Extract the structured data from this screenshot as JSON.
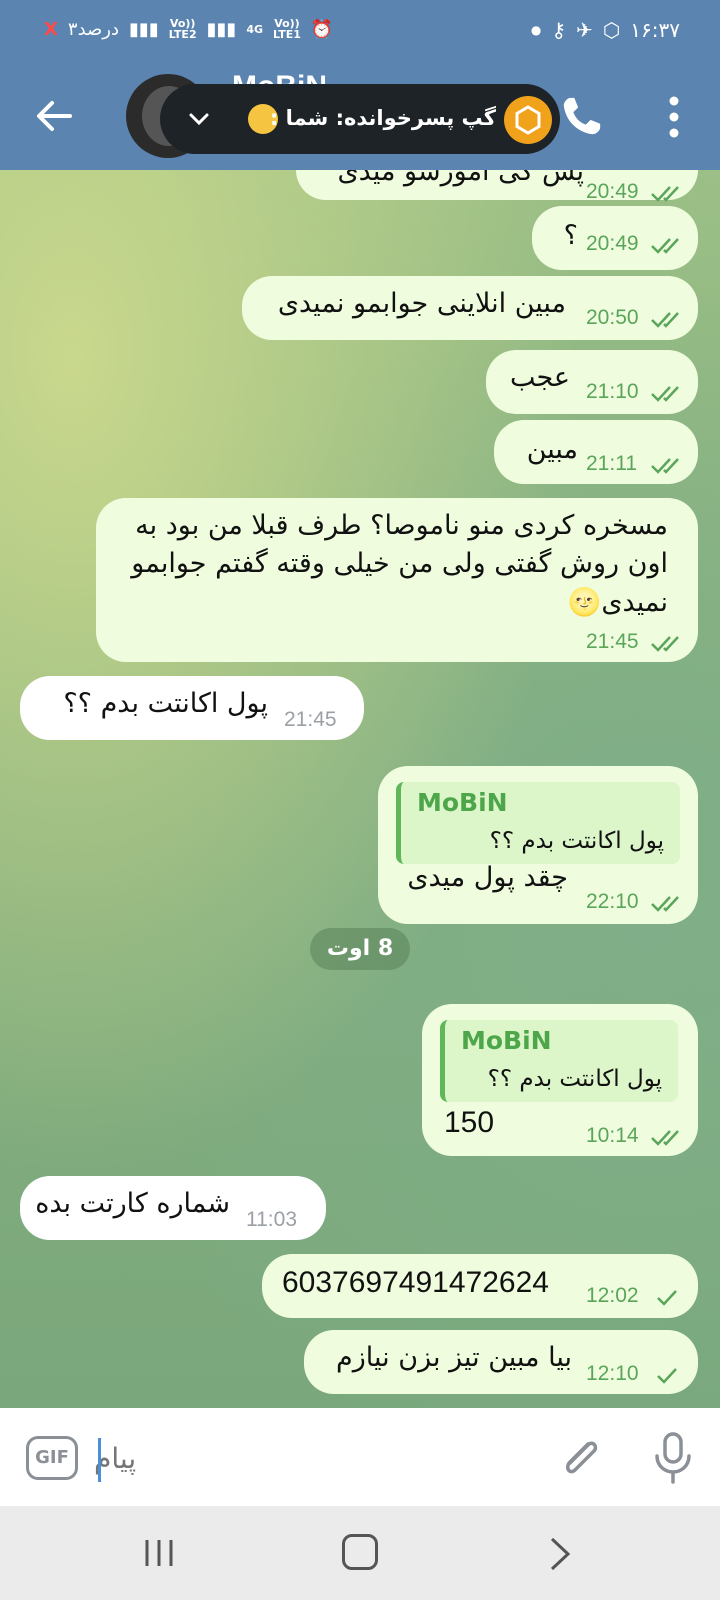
{
  "status_bar": {
    "time": "۱۶:۳۷",
    "battery": "۳درصد",
    "sim1": "LTE2",
    "sim2": "LTE1",
    "net": "4G"
  },
  "notification": {
    "text": "گپ پسرخوانده: شما :",
    "emoji": "😐"
  },
  "header": {
    "contact_name": "MoBiN"
  },
  "messages": [
    {
      "text": "پس کی آمورشو میدی",
      "time": "20:49",
      "checks": 2
    },
    {
      "text": "؟",
      "time": "20:49",
      "checks": 2
    },
    {
      "text": "مبین انلاینی جوابمو نمیدی",
      "time": "20:50",
      "checks": 2
    },
    {
      "text": "عجب",
      "time": "21:10",
      "checks": 2
    },
    {
      "text": "مبین",
      "time": "21:11",
      "checks": 2
    },
    {
      "lines": [
        "مسخره کردی منو ناموصا؟ طرف قبلا من بود به",
        "اون روش گفتی ولی من خیلی وقته گفتم جوابمو",
        "نمیدی🌝"
      ],
      "time": "21:45",
      "checks": 2
    },
    {
      "text": "پول اکانتت بدم ؟؟",
      "time": "21:45"
    },
    {
      "reply_name": "MoBiN",
      "reply_text": "پول اکانتت بدم ؟؟",
      "text": "چقد پول میدی",
      "time": "22:10",
      "checks": 2
    },
    {
      "reply_name": "MoBiN",
      "reply_text": "پول اکانتت بدم ؟؟",
      "text": "150",
      "time": "10:14",
      "checks": 2
    },
    {
      "text": "شماره کارتت بده",
      "time": "11:03"
    },
    {
      "text": "6037697491472624",
      "time": "12:02",
      "checks": 1
    },
    {
      "text": "بیا مبین تیز بزن نیازم",
      "time": "12:10",
      "checks": 1
    }
  ],
  "date_separator": "8 اوت",
  "input": {
    "placeholder": "پیام",
    "gif_label": "GIF"
  },
  "colors": {
    "header": "#5b84b0",
    "outgoing_bubble": "#effdde",
    "incoming_bubble": "#ffffff",
    "check_color": "#5aa55a"
  }
}
